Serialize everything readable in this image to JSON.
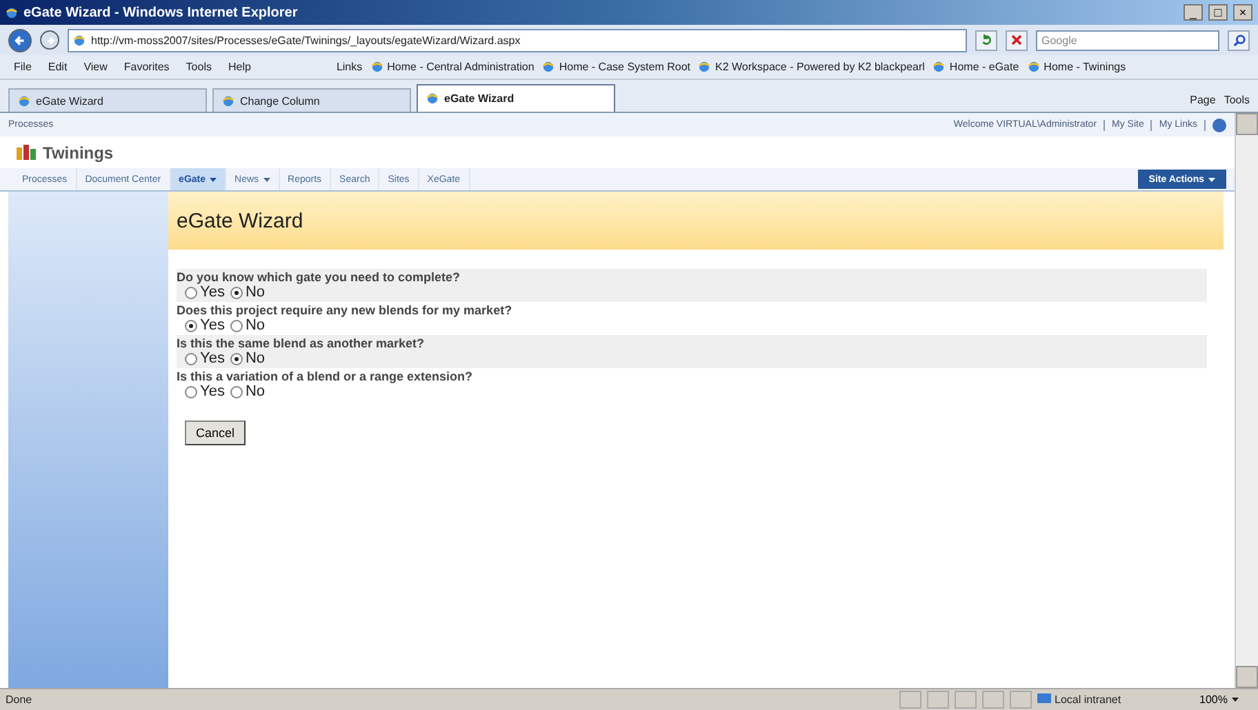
{
  "window": {
    "title": "eGate Wizard - Windows Internet Explorer",
    "controls": [
      "_",
      "□",
      "×"
    ]
  },
  "address": {
    "url": "http://vm-moss2007/sites/Processes/eGate/Twinings/_layouts/egateWizard/Wizard.aspx"
  },
  "search": {
    "placeholder": "Google"
  },
  "menu": [
    "File",
    "Edit",
    "View",
    "Favorites",
    "Tools",
    "Help"
  ],
  "links": {
    "label": "Links",
    "items": [
      "Home - Central Administration",
      "Home - Case System Root",
      "K2 Workspace - Powered by K2 blackpearl",
      "Home - eGate",
      "Home - Twinings"
    ]
  },
  "tabs": [
    {
      "label": "eGate Wizard",
      "selected": false
    },
    {
      "label": "Change Column",
      "selected": false
    },
    {
      "label": "eGate Wizard",
      "selected": true
    }
  ],
  "page_tools": [
    "Page",
    "Tools"
  ],
  "site": {
    "breadcrumb": "Processes",
    "welcome": "Welcome VIRTUAL\\Administrator",
    "my_site": "My Site",
    "my_links": "My Links",
    "title": "Twinings",
    "site_actions": "Site Actions"
  },
  "nav": [
    {
      "label": "Processes",
      "selected": false,
      "dropdown": false
    },
    {
      "label": "Document Center",
      "selected": false,
      "dropdown": false
    },
    {
      "label": "eGate",
      "selected": true,
      "dropdown": true
    },
    {
      "label": "News",
      "selected": false,
      "dropdown": true
    },
    {
      "label": "Reports",
      "selected": false,
      "dropdown": false
    },
    {
      "label": "Search",
      "selected": false,
      "dropdown": false
    },
    {
      "label": "Sites",
      "selected": false,
      "dropdown": false
    },
    {
      "label": "XeGate",
      "selected": false,
      "dropdown": false
    }
  ],
  "wizard": {
    "title": "eGate Wizard",
    "questions": [
      {
        "text": "Do you know which gate you need to complete?",
        "options": [
          {
            "label": "Yes",
            "selected": false
          },
          {
            "label": "No",
            "selected": true
          }
        ]
      },
      {
        "text": "Does this project require any new blends for my market?",
        "options": [
          {
            "label": "Yes",
            "selected": true
          },
          {
            "label": "No",
            "selected": false
          }
        ]
      },
      {
        "text": "Is this the same blend as another market?",
        "options": [
          {
            "label": "Yes",
            "selected": false
          },
          {
            "label": "No",
            "selected": true
          }
        ]
      },
      {
        "text": "Is this a variation of a blend or a range extension?",
        "options": [
          {
            "label": "Yes",
            "selected": false
          },
          {
            "label": "No",
            "selected": false
          }
        ]
      }
    ],
    "cancel": "Cancel"
  },
  "status_bar": {
    "text": "Done",
    "zone": "Local intranet",
    "zoom": "100%"
  }
}
